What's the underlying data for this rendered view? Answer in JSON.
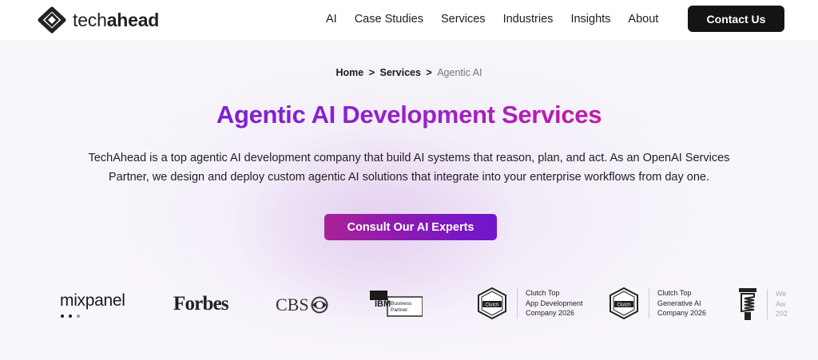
{
  "header": {
    "logo_text_light": "tech",
    "logo_text_bold": "ahead",
    "nav": [
      "AI",
      "Case Studies",
      "Services",
      "Industries",
      "Insights",
      "About"
    ],
    "contact_label": "Contact Us"
  },
  "breadcrumb": {
    "home": "Home",
    "services": "Services",
    "current": "Agentic AI",
    "separator": ">"
  },
  "hero": {
    "title": "Agentic AI Development Services",
    "description": "TechAhead is a top agentic AI development company that build AI systems that reason, plan, and act. As an OpenAI Services Partner, we design and deploy custom agentic AI solutions that integrate into your enterprise workflows from day one.",
    "cta_label": "Consult Our AI Experts",
    "title_gradient": [
      "#7a1fd6",
      "#c21ba9"
    ],
    "cta_gradient": [
      "#a92296",
      "#6f16cf"
    ]
  },
  "logos": {
    "mixpanel": "mixpanel",
    "forbes": "Forbes",
    "cbs": "CBS",
    "ibm": "IBM",
    "ibm_badge_line1": "Business",
    "ibm_badge_line2": "Partner",
    "clutch_badge": "Clutch",
    "clutch1": [
      "Clutch Top",
      "App Development",
      "Company 2026"
    ],
    "clutch2": [
      "Clutch Top",
      "Generative AI",
      "Company 2026"
    ],
    "award_partial": [
      "We",
      "Aw",
      "202"
    ]
  }
}
